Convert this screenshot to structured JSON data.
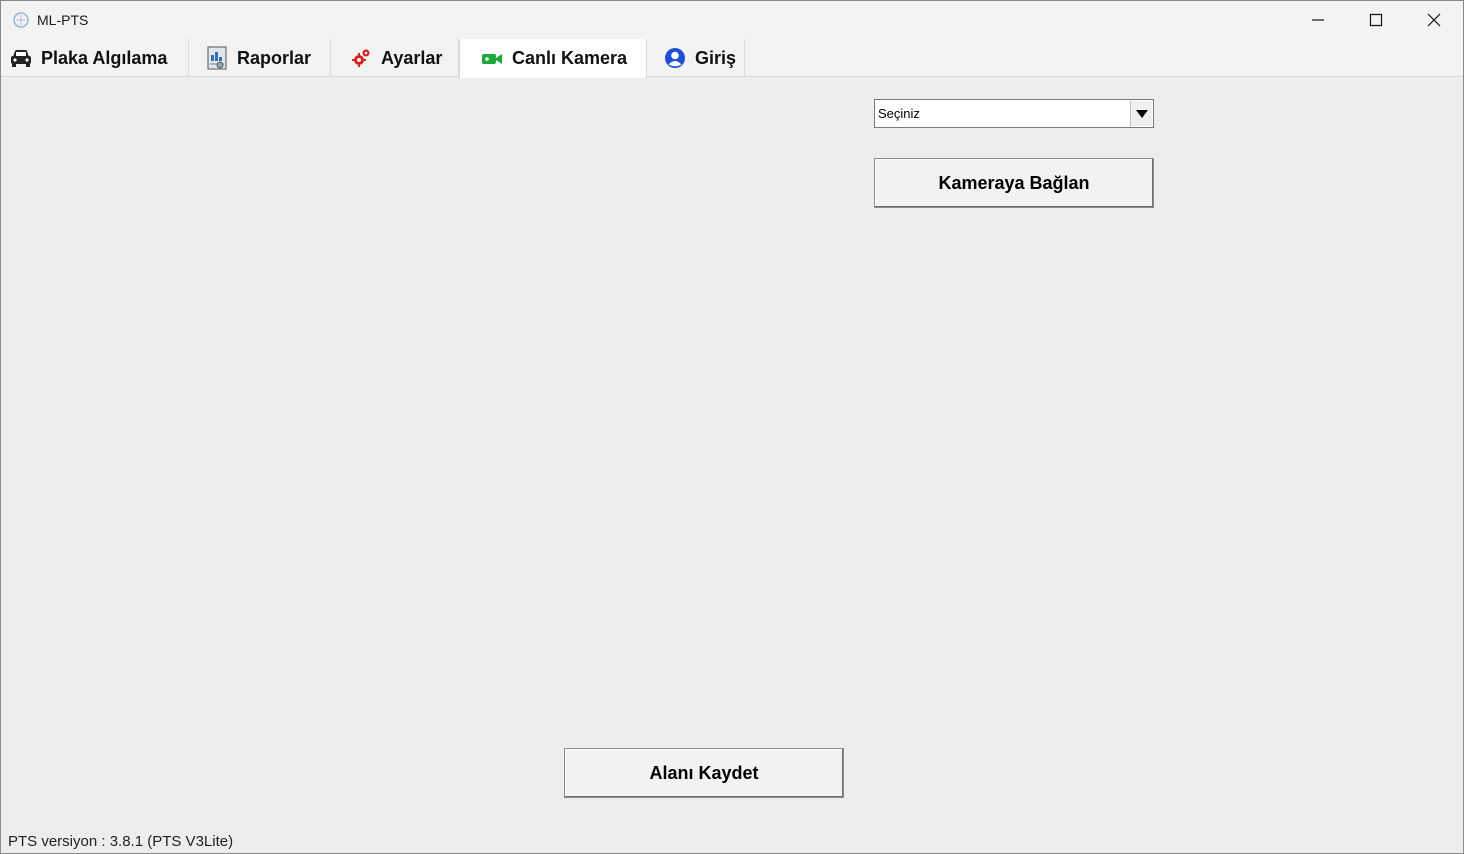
{
  "window": {
    "title": "ML-PTS",
    "controls": {
      "minimize_icon": "minimize-icon",
      "maximize_icon": "maximize-icon",
      "close_icon": "close-icon"
    }
  },
  "tabs": [
    {
      "label": "Plaka Algılama",
      "icon": "car-icon",
      "active": false
    },
    {
      "label": "Raporlar",
      "icon": "report-icon",
      "active": false
    },
    {
      "label": "Ayarlar",
      "icon": "gears-icon",
      "active": false
    },
    {
      "label": "Canlı Kamera",
      "icon": "video-camera-icon",
      "active": true
    },
    {
      "label": "Giriş",
      "icon": "user-icon",
      "active": false
    }
  ],
  "camera": {
    "select_value": "Seçiniz",
    "connect_label": "Kameraya Bağlan"
  },
  "save_label": "Alanı Kaydet",
  "status": {
    "version_text": "PTS versiyon : 3.8.1 (PTS V3Lite)"
  },
  "colors": {
    "accent_green": "#1fa83a",
    "accent_red": "#d62020",
    "accent_blue": "#1e4fd8"
  }
}
